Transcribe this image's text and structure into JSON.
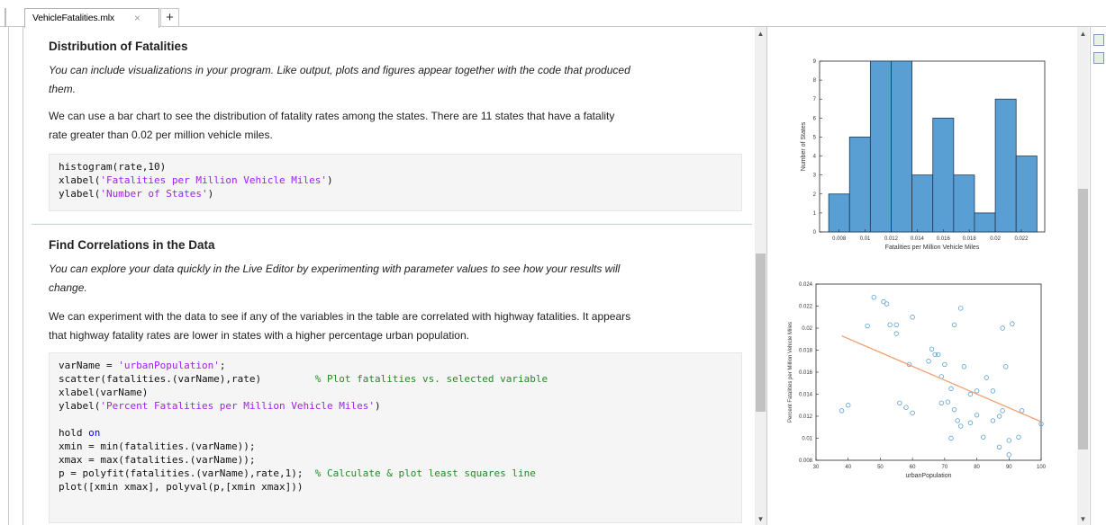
{
  "tab": {
    "title": "VehicleFatalities.mlx",
    "close": "×",
    "add": "+"
  },
  "section1": {
    "heading": "Distribution of Fatalities",
    "para1_line1": "You can include visualizations in your program. Like output, plots and figures appear together with the code that produced",
    "para1_line2": "them.",
    "para2_line1": "We can use a bar chart to see the distribution of fatality rates among the states. There are 11 states that have a fatality",
    "para2_line2": "rate greater than 0.02 per million vehicle miles.",
    "code": {
      "l1a": "histogram(rate,10)",
      "l2a": "xlabel(",
      "l2s": "'Fatalities per Million Vehicle Miles'",
      "l2b": ")",
      "l3a": "ylabel(",
      "l3s": "'Number of States'",
      "l3b": ")"
    }
  },
  "section2": {
    "heading": "Find Correlations in the Data",
    "para1_line1": "You can explore your data quickly in the Live Editor by experimenting with parameter values to see how your results will",
    "para1_line2": "change.",
    "para2_line1": "We can experiment with the data to see if any of the variables in the table are correlated with highway fatalities. It appears",
    "para2_line2": "that highway fatality rates are lower in states with a higher percentage urban population.",
    "code": {
      "l1a": "varName = ",
      "l1s": "'urbanPopulation'",
      "l1b": ";",
      "l2a": "scatter(fatalities.(varName),rate)         ",
      "l2c": "% Plot fatalities vs. selected variable",
      "l3a": "xlabel(varName)",
      "l4a": "ylabel(",
      "l4s": "'Percent Fatalities per Million Vehicle Miles'",
      "l4b": ")",
      "l6a": "hold ",
      "l6k": "on",
      "l7a": "xmin = min(fatalities.(varName));",
      "l8a": "xmax = max(fatalities.(varName));",
      "l9a": "p = polyfit(fatalities.(varName),rate,1);  ",
      "l9c": "% Calculate & plot least squares line",
      "l10a": "plot([xmin xmax], polyval(p,[xmin xmax]))"
    }
  },
  "chart_data": [
    {
      "type": "bar",
      "title": "",
      "xlabel": "Fatalities per Million Vehicle Miles",
      "ylabel": "Number of States",
      "bin_edges": [
        0.0072,
        0.0088,
        0.0104,
        0.012,
        0.0136,
        0.0152,
        0.0168,
        0.0184,
        0.02,
        0.0216,
        0.0232
      ],
      "values": [
        2,
        5,
        9,
        9,
        3,
        6,
        3,
        1,
        7,
        4
      ],
      "xticks": [
        "0.008",
        "0.01",
        "0.012",
        "0.014",
        "0.016",
        "0.018",
        "0.02",
        "0.022"
      ],
      "xtick_values": [
        0.008,
        0.01,
        0.012,
        0.014,
        0.016,
        0.018,
        0.02,
        0.022
      ],
      "xlim": [
        0.0065,
        0.0238
      ],
      "yticks": [
        "0",
        "1",
        "2",
        "3",
        "4",
        "5",
        "6",
        "7",
        "8",
        "9"
      ],
      "ylim": [
        0,
        9
      ],
      "bar_color": "#5a9fd4"
    },
    {
      "type": "scatter",
      "title": "",
      "xlabel": "urbanPopulation",
      "ylabel": "Percent Fatalities per Million Vehicle Miles",
      "xlim": [
        30,
        100
      ],
      "ylim": [
        0.008,
        0.024
      ],
      "xticks": [
        "30",
        "40",
        "50",
        "60",
        "70",
        "80",
        "90",
        "100"
      ],
      "yticks": [
        "0.008",
        "0.01",
        "0.012",
        "0.014",
        "0.016",
        "0.018",
        "0.02",
        "0.022",
        "0.024"
      ],
      "points": [
        [
          38,
          0.0125
        ],
        [
          40,
          0.013
        ],
        [
          46,
          0.0202
        ],
        [
          48,
          0.0228
        ],
        [
          51,
          0.0224
        ],
        [
          52,
          0.0222
        ],
        [
          53,
          0.0203
        ],
        [
          55,
          0.0203
        ],
        [
          55,
          0.0195
        ],
        [
          56,
          0.0132
        ],
        [
          58,
          0.0128
        ],
        [
          59,
          0.0167
        ],
        [
          60,
          0.0123
        ],
        [
          60,
          0.021
        ],
        [
          65,
          0.017
        ],
        [
          66,
          0.0181
        ],
        [
          67,
          0.0176
        ],
        [
          68,
          0.0176
        ],
        [
          69,
          0.0156
        ],
        [
          69,
          0.0132
        ],
        [
          70,
          0.0167
        ],
        [
          71,
          0.0133
        ],
        [
          72,
          0.01
        ],
        [
          72,
          0.0145
        ],
        [
          73,
          0.0203
        ],
        [
          73,
          0.0126
        ],
        [
          74,
          0.0116
        ],
        [
          75,
          0.0218
        ],
        [
          75,
          0.0111
        ],
        [
          76,
          0.0165
        ],
        [
          78,
          0.014
        ],
        [
          78,
          0.0114
        ],
        [
          80,
          0.0143
        ],
        [
          80,
          0.0121
        ],
        [
          82,
          0.0101
        ],
        [
          83,
          0.0155
        ],
        [
          85,
          0.0116
        ],
        [
          85,
          0.0143
        ],
        [
          87,
          0.012
        ],
        [
          87,
          0.0092
        ],
        [
          88,
          0.0125
        ],
        [
          88,
          0.02
        ],
        [
          89,
          0.0165
        ],
        [
          90,
          0.0085
        ],
        [
          90,
          0.0098
        ],
        [
          91,
          0.0204
        ],
        [
          93,
          0.0101
        ],
        [
          94,
          0.0125
        ],
        [
          100,
          0.0113
        ]
      ],
      "fit_line": {
        "x": [
          38,
          100
        ],
        "y": [
          0.0193,
          0.0115
        ]
      },
      "point_color": "#5a9fd4",
      "line_color": "#f0a070"
    }
  ]
}
